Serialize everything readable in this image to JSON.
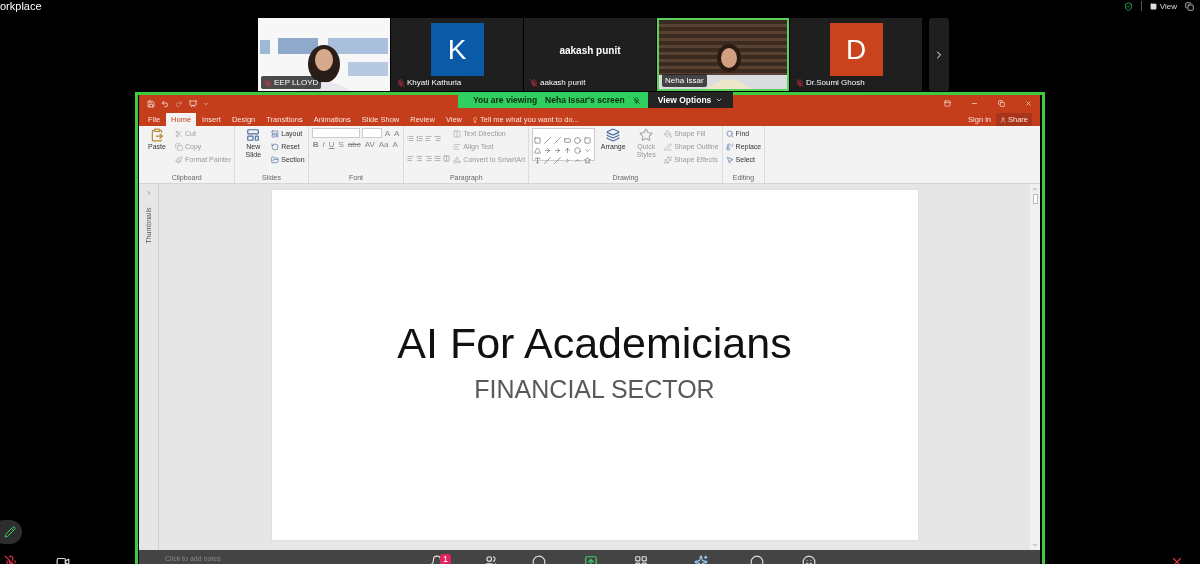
{
  "app": {
    "title": "orkplace",
    "view_label": "View"
  },
  "participants": [
    {
      "name": "EEP LLOYD",
      "kind": "video",
      "muted": true,
      "speaking": false
    },
    {
      "name": "Khyati Kathuria",
      "kind": "avatar",
      "initial": "K",
      "color": "#0a5aa8",
      "muted": true,
      "speaking": false
    },
    {
      "name": "aakash punit",
      "kind": "name",
      "display": "aakash punit",
      "muted": true,
      "speaking": false
    },
    {
      "name": "Neha Issar",
      "kind": "video",
      "muted": false,
      "speaking": true
    },
    {
      "name": "Dr.Soumi Ghosh",
      "kind": "avatar",
      "initial": "D",
      "color": "#c9431c",
      "muted": true,
      "speaking": false
    }
  ],
  "share": {
    "viewing": "You are viewing",
    "presenter": "Neha Issar's screen",
    "options": "View Options"
  },
  "powerpoint": {
    "tabs": [
      {
        "label": "File",
        "selected": false
      },
      {
        "label": "Home",
        "selected": true
      },
      {
        "label": "Insert",
        "selected": false
      },
      {
        "label": "Design",
        "selected": false
      },
      {
        "label": "Transitions",
        "selected": false
      },
      {
        "label": "Animations",
        "selected": false
      },
      {
        "label": "Slide Show",
        "selected": false
      },
      {
        "label": "Review",
        "selected": false
      },
      {
        "label": "View",
        "selected": false
      }
    ],
    "tell_me": "Tell me what you want to do...",
    "sign_in": "Sign in",
    "share": "Share",
    "ribbon": [
      {
        "label": "Clipboard",
        "kind": "tools",
        "items": [
          {
            "label": "Paste",
            "kind": "large",
            "disabled": false
          },
          {
            "label": "Cut",
            "kind": "small",
            "disabled": true
          },
          {
            "label": "Copy",
            "kind": "small",
            "disabled": true
          },
          {
            "label": "Format Painter",
            "kind": "small",
            "disabled": true
          }
        ]
      },
      {
        "label": "Slides",
        "kind": "tools",
        "items": [
          {
            "label": "New Slide",
            "kind": "large",
            "disabled": false
          },
          {
            "label": "Layout",
            "kind": "small",
            "disabled": false
          },
          {
            "label": "Reset",
            "kind": "small",
            "disabled": false
          },
          {
            "label": "Section",
            "kind": "small",
            "disabled": false
          }
        ]
      },
      {
        "label": "Font",
        "kind": "font",
        "grow": [
          "A",
          "A"
        ],
        "glyphs": [
          "B",
          "I",
          "U",
          "S",
          "abc",
          "AV",
          "Aa",
          "A"
        ]
      },
      {
        "label": "Paragraph",
        "kind": "paragraph",
        "items": [
          {
            "label": "Text Direction",
            "kind": "small",
            "disabled": true
          },
          {
            "label": "Align Text",
            "kind": "small",
            "disabled": true
          },
          {
            "label": "Convert to SmartArt",
            "kind": "small",
            "disabled": true
          }
        ]
      },
      {
        "label": "Drawing",
        "kind": "drawing",
        "items": [
          {
            "label": "Arrange",
            "kind": "large",
            "disabled": false
          },
          {
            "label": "Quick Styles",
            "kind": "large",
            "disabled": true
          },
          {
            "label": "Shape Fill",
            "kind": "small",
            "disabled": true
          },
          {
            "label": "Shape Outline",
            "kind": "small",
            "disabled": true
          },
          {
            "label": "Shape Effects",
            "kind": "small",
            "disabled": true
          }
        ]
      },
      {
        "label": "Editing",
        "kind": "tools",
        "items": [
          {
            "label": "Find",
            "kind": "small",
            "disabled": false
          },
          {
            "label": "Replace",
            "kind": "small",
            "disabled": false
          },
          {
            "label": "Select",
            "kind": "small",
            "disabled": false
          }
        ]
      }
    ],
    "thumbnails": "Thumbnails",
    "slide": {
      "title": "AI For Academicians",
      "subtitle": "FINANCIAL SECTOR"
    },
    "notes": "Click to add notes"
  },
  "toolbar": {
    "mic_muted": true,
    "badge": "1"
  }
}
